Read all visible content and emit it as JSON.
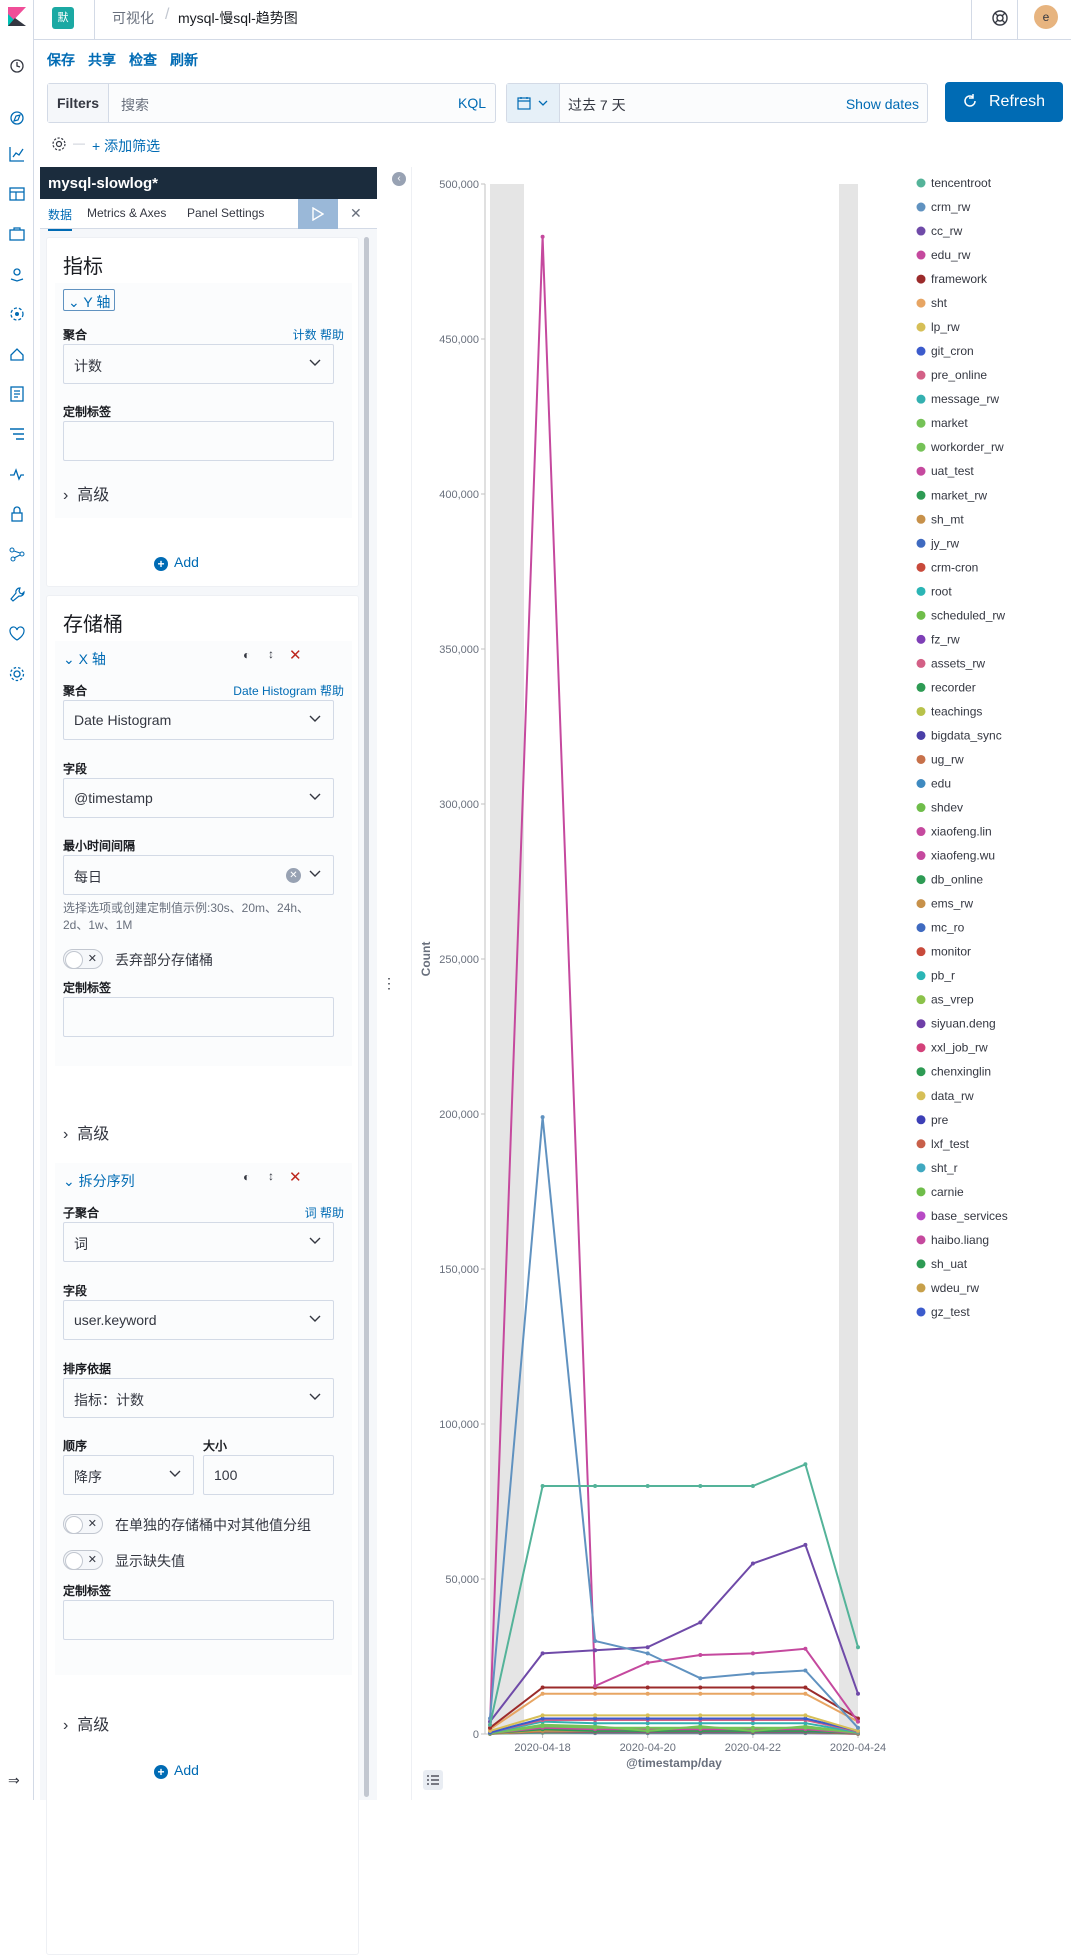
{
  "topbar": {
    "space_letter": "默",
    "breadcrumb_parent": "可视化",
    "breadcrumb_sep": "/",
    "breadcrumb_current": "mysql-慢sql-趋势图",
    "avatar_letter": "e"
  },
  "menu": {
    "save": "保存",
    "share": "共享",
    "inspect": "检查",
    "refresh": "刷新"
  },
  "query": {
    "filters_label": "Filters",
    "placeholder": "搜索",
    "kql": "KQL"
  },
  "time": {
    "range": "过去 7 天",
    "show_dates": "Show dates",
    "refresh_button": "Refresh"
  },
  "filters": {
    "add_filter": "+ 添加筛选"
  },
  "editor": {
    "title": "mysql-slowlog*",
    "tabs": [
      "数据",
      "Metrics & Axes",
      "Panel Settings"
    ],
    "metrics": {
      "title": "指标",
      "y_axis": "Y 轴",
      "agg_label": "聚合",
      "agg_help": "计数 帮助",
      "agg_value": "计数",
      "custom_label": "定制标签",
      "advanced": "高级",
      "add": "Add"
    },
    "buckets": {
      "title": "存储桶",
      "x_axis": {
        "header": "X 轴",
        "agg_label": "聚合",
        "agg_help": "Date Histogram 帮助",
        "agg_value": "Date Histogram",
        "field_label": "字段",
        "field_value": "@timestamp",
        "interval_label": "最小时间间隔",
        "interval_value": "每日",
        "interval_help": "选择选项或创建定制值示例:30s、20m、24h、2d、1w、1M",
        "drop_partial": "丢弃部分存储桶",
        "custom_label": "定制标签",
        "advanced": "高级"
      },
      "split": {
        "header": "拆分序列",
        "sub_agg_label": "子聚合",
        "sub_agg_help": "词 帮助",
        "sub_agg_value": "词",
        "field_label": "字段",
        "field_value": "user.keyword",
        "order_by_label": "排序依据",
        "order_by_value": "指标：计数",
        "order_label": "顺序",
        "order_value": "降序",
        "size_label": "大小",
        "size_value": "100",
        "group_other": "在单独的存储桶中对其他值分组",
        "show_missing": "显示缺失值",
        "custom_label": "定制标签",
        "advanced": "高级"
      },
      "add": "Add"
    }
  },
  "chart_data": {
    "type": "line",
    "xlabel": "@timestamp/day",
    "ylabel": "Count",
    "ylim": [
      0,
      500000
    ],
    "yticks": [
      0,
      50000,
      100000,
      150000,
      200000,
      250000,
      300000,
      350000,
      400000,
      450000,
      500000
    ],
    "ytick_labels": [
      "0",
      "50,000",
      "100,000",
      "150,000",
      "200,000",
      "250,000",
      "300,000",
      "350,000",
      "400,000",
      "450,000",
      "500,000"
    ],
    "xtick_labels": [
      "2020-04-18",
      "2020-04-20",
      "2020-04-22",
      "2020-04-24"
    ],
    "x": [
      "2020-04-17",
      "2020-04-18",
      "2020-04-19",
      "2020-04-20",
      "2020-04-21",
      "2020-04-22",
      "2020-04-23",
      "2020-04-24"
    ],
    "legend_position": "right",
    "grid": false,
    "series": [
      {
        "name": "tencentroot",
        "color": "#54b399",
        "values": [
          3000,
          80000,
          80000,
          80000,
          80000,
          80000,
          87000,
          28000
        ]
      },
      {
        "name": "crm_rw",
        "color": "#6092c0",
        "values": [
          5000,
          199000,
          30000,
          26000,
          18000,
          19500,
          20500,
          2000
        ]
      },
      {
        "name": "cc_rw",
        "color": "#6f4aa8",
        "values": [
          4000,
          26000,
          27000,
          28000,
          36000,
          55000,
          61000,
          13000
        ]
      },
      {
        "name": "edu_rw",
        "color": "#c5499e",
        "values": [
          3000,
          483000,
          15500,
          23000,
          25500,
          26000,
          27500,
          4000
        ]
      },
      {
        "name": "framework",
        "color": "#9b2b2b",
        "values": [
          2000,
          15000,
          15000,
          15000,
          15000,
          15000,
          15000,
          5000
        ]
      },
      {
        "name": "sht",
        "color": "#e7a563",
        "values": [
          1500,
          13000,
          13000,
          13000,
          13000,
          13000,
          13000,
          4000
        ]
      },
      {
        "name": "lp_rw",
        "color": "#d6bf57",
        "values": [
          1000,
          6000,
          6000,
          6000,
          6000,
          6000,
          6000,
          1000
        ]
      },
      {
        "name": "git_cron",
        "color": "#3c5bcc",
        "values": [
          500,
          5000,
          5000,
          5000,
          5000,
          5000,
          5000,
          1000
        ]
      },
      {
        "name": "pre_online",
        "color": "#d36086",
        "values": [
          500,
          4500,
          4500,
          4500,
          4500,
          4500,
          4500,
          800
        ]
      },
      {
        "name": "message_rw",
        "color": "#34b0b0",
        "values": [
          400,
          4000,
          3500,
          3500,
          3500,
          3500,
          3500,
          600
        ]
      },
      {
        "name": "market",
        "color": "#75c257",
        "values": [
          300,
          3000,
          2500,
          1000,
          2500,
          1000,
          2500,
          500
        ]
      },
      {
        "name": "workorder_rw",
        "color": "#75c257",
        "values": [
          200,
          2500,
          2000,
          2000,
          2000,
          2000,
          2000,
          400
        ]
      },
      {
        "name": "uat_test",
        "color": "#c5499e",
        "values": [
          200,
          2000,
          1500,
          1500,
          1500,
          1500,
          1500,
          300
        ]
      },
      {
        "name": "market_rw",
        "color": "#2e9b54",
        "values": [
          200,
          1500,
          1000,
          1000,
          1000,
          1000,
          1000,
          300
        ]
      },
      {
        "name": "sh_mt",
        "color": "#c7914a",
        "values": [
          100,
          1000,
          1000,
          1000,
          1000,
          1000,
          1000,
          200
        ]
      },
      {
        "name": "jy_rw",
        "color": "#3f6ac0",
        "values": [
          100,
          1000,
          800,
          800,
          800,
          800,
          800,
          200
        ]
      },
      {
        "name": "crm-cron",
        "color": "#c84a3b",
        "values": [
          100,
          800,
          600,
          600,
          600,
          600,
          600,
          100
        ]
      },
      {
        "name": "root",
        "color": "#2bb5b5",
        "values": [
          100,
          600,
          500,
          500,
          500,
          500,
          500,
          100
        ]
      },
      {
        "name": "scheduled_rw",
        "color": "#6fbd4a",
        "values": [
          100,
          500,
          400,
          400,
          400,
          400,
          400,
          100
        ]
      },
      {
        "name": "fz_rw",
        "color": "#7e3fb6",
        "values": [
          100,
          400,
          300,
          300,
          300,
          300,
          300,
          100
        ]
      }
    ],
    "legend": [
      {
        "name": "tencentroot",
        "color": "#54b399"
      },
      {
        "name": "crm_rw",
        "color": "#6092c0"
      },
      {
        "name": "cc_rw",
        "color": "#6f4aa8"
      },
      {
        "name": "edu_rw",
        "color": "#c5499e"
      },
      {
        "name": "framework",
        "color": "#9b2b2b"
      },
      {
        "name": "sht",
        "color": "#e7a563"
      },
      {
        "name": "lp_rw",
        "color": "#d6bf57"
      },
      {
        "name": "git_cron",
        "color": "#3c5bcc"
      },
      {
        "name": "pre_online",
        "color": "#d36086"
      },
      {
        "name": "message_rw",
        "color": "#34b0b0"
      },
      {
        "name": "market",
        "color": "#75c257"
      },
      {
        "name": "workorder_rw",
        "color": "#75c257"
      },
      {
        "name": "uat_test",
        "color": "#c5499e"
      },
      {
        "name": "market_rw",
        "color": "#2e9b54"
      },
      {
        "name": "sh_mt",
        "color": "#c7914a"
      },
      {
        "name": "jy_rw",
        "color": "#3f6ac0"
      },
      {
        "name": "crm-cron",
        "color": "#c84a3b"
      },
      {
        "name": "root",
        "color": "#2bb5b5"
      },
      {
        "name": "scheduled_rw",
        "color": "#6fbd4a"
      },
      {
        "name": "fz_rw",
        "color": "#7e3fb6"
      },
      {
        "name": "assets_rw",
        "color": "#d36086"
      },
      {
        "name": "recorder",
        "color": "#2e9b54"
      },
      {
        "name": "teachings",
        "color": "#b8c24a"
      },
      {
        "name": "bigdata_sync",
        "color": "#4a3fa8"
      },
      {
        "name": "ug_rw",
        "color": "#c7714a"
      },
      {
        "name": "edu",
        "color": "#3f8ac0"
      },
      {
        "name": "shdev",
        "color": "#6fbd4a"
      },
      {
        "name": "xiaofeng.lin",
        "color": "#c5499e"
      },
      {
        "name": "xiaofeng.wu",
        "color": "#c5499e"
      },
      {
        "name": "db_online",
        "color": "#2e9b54"
      },
      {
        "name": "ems_rw",
        "color": "#c7914a"
      },
      {
        "name": "mc_ro",
        "color": "#3f6ac0"
      },
      {
        "name": "monitor",
        "color": "#c84a3b"
      },
      {
        "name": "pb_r",
        "color": "#2bb5b5"
      },
      {
        "name": "as_vrep",
        "color": "#8bc24a"
      },
      {
        "name": "siyuan.deng",
        "color": "#6f3fa8"
      },
      {
        "name": "xxl_job_rw",
        "color": "#d3417a"
      },
      {
        "name": "chenxinglin",
        "color": "#2e9b54"
      },
      {
        "name": "data_rw",
        "color": "#d6bf57"
      },
      {
        "name": "pre",
        "color": "#3c3fb6"
      },
      {
        "name": "lxf_test",
        "color": "#c8604a"
      },
      {
        "name": "sht_r",
        "color": "#3fa8c0"
      },
      {
        "name": "carnie",
        "color": "#6fbd4a"
      },
      {
        "name": "base_services",
        "color": "#b84ac5"
      },
      {
        "name": "haibo.liang",
        "color": "#c5499e"
      },
      {
        "name": "sh_uat",
        "color": "#2e9b54"
      },
      {
        "name": "wdeu_rw",
        "color": "#c7a04a"
      },
      {
        "name": "gz_test",
        "color": "#3c5bcc"
      }
    ]
  }
}
